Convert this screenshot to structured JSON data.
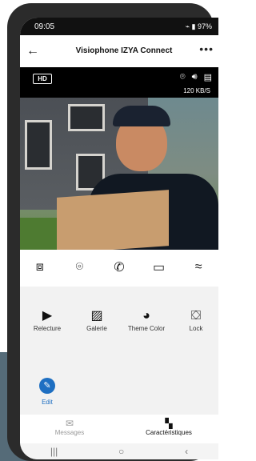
{
  "status_bar": {
    "time": "09:05",
    "right": "97%"
  },
  "header": {
    "title": "Visiophone IZYA Connect",
    "back_icon": "arrow-left-icon",
    "more_icon": "more-horiz-icon",
    "more": "•••"
  },
  "video": {
    "hd_badge": "HD",
    "speed": "120 KB/S",
    "icons": [
      "camera-icon",
      "speaker-icon",
      "menu-icon"
    ]
  },
  "controls": [
    {
      "name": "screenshot-icon",
      "glyph": "▣"
    },
    {
      "name": "camera-icon",
      "glyph": "◎"
    },
    {
      "name": "call-icon",
      "glyph": "☎"
    },
    {
      "name": "video-record-icon",
      "glyph": "▭"
    },
    {
      "name": "collapse-icon",
      "glyph": "≈"
    }
  ],
  "features": {
    "replay": "Relecture",
    "gallery": "Galerie",
    "theme": "Theme Color",
    "lock": "Lock",
    "edit": "Edit"
  },
  "tabs": {
    "messages": "Messages",
    "characteristics": "Caractéristiques"
  },
  "colors": {
    "accent": "#1e6fc2",
    "video_bg": "#000000"
  }
}
